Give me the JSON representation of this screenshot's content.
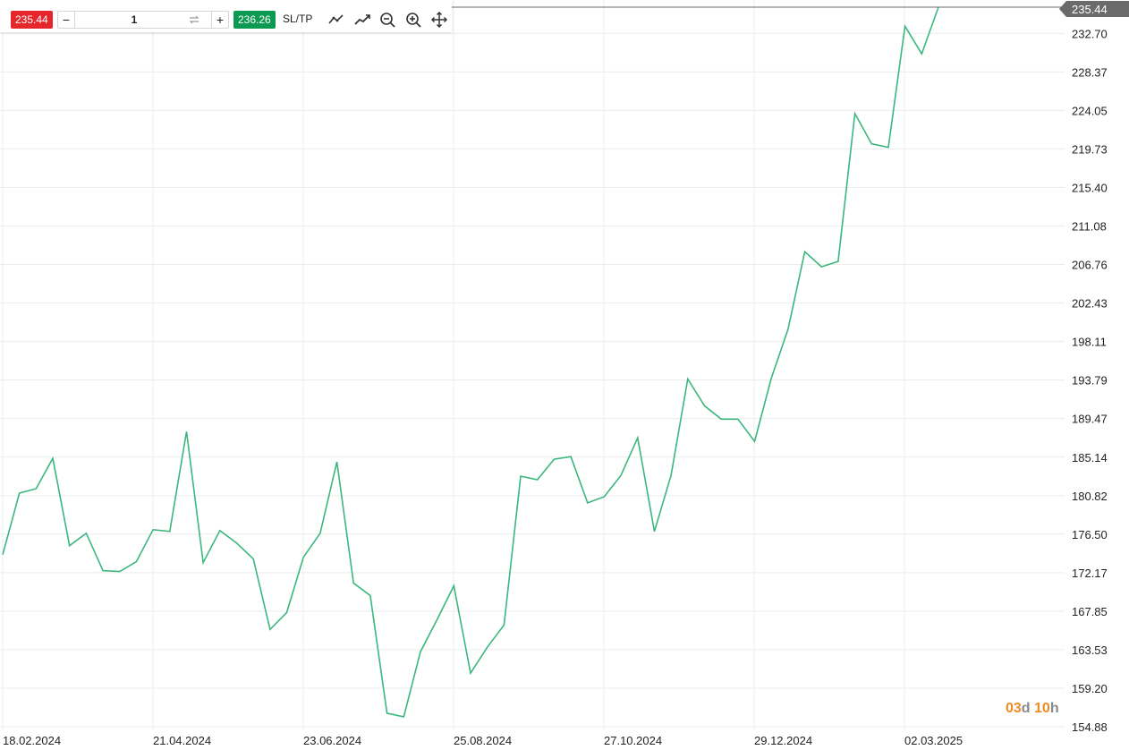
{
  "toolbar": {
    "sell_price": "235.44",
    "buy_price": "236.26",
    "quantity": "1",
    "minus_label": "−",
    "plus_label": "+",
    "sltp_label": "SL/TP",
    "icons": [
      "line-chart-icon",
      "trend-chart-icon",
      "zoom-out-icon",
      "zoom-in-icon",
      "pan-move-icon"
    ]
  },
  "colors": {
    "sell": "#e5262b",
    "buy": "#0c9a52",
    "line": "#3bb77e",
    "grid": "#ececec",
    "price_tag": "#6b6b6b",
    "timer_accent": "#f08a24",
    "timer_muted": "#8a8a8a"
  },
  "timer": {
    "days": "03",
    "days_unit": "d",
    "hours": "10",
    "hours_unit": "h"
  },
  "chart_data": {
    "type": "line",
    "current_price": "235.44",
    "ylim": [
      154.88,
      235.44
    ],
    "y_ticks": [
      "232.70",
      "228.37",
      "224.05",
      "219.73",
      "215.40",
      "211.08",
      "206.76",
      "202.43",
      "198.11",
      "193.79",
      "189.47",
      "185.14",
      "180.82",
      "176.50",
      "172.17",
      "167.85",
      "163.53",
      "159.20",
      "154.88"
    ],
    "x_ticks": [
      "18.02.2024",
      "21.04.2024",
      "23.06.2024",
      "25.08.2024",
      "27.10.2024",
      "29.12.2024",
      "02.03.2025"
    ],
    "series": [
      {
        "values": [
          174.2,
          181.1,
          181.6,
          185.0,
          175.2,
          176.6,
          172.4,
          172.3,
          173.4,
          177.0,
          176.8,
          188.0,
          173.3,
          176.9,
          175.5,
          173.7,
          165.8,
          167.7,
          173.9,
          176.6,
          184.6,
          171.0,
          169.6,
          156.4,
          156.0,
          163.3,
          166.9,
          170.7,
          160.9,
          163.8,
          166.3,
          183.0,
          182.6,
          184.9,
          185.2,
          180.0,
          180.7,
          183.1,
          187.3,
          176.8,
          183.1,
          193.9,
          190.9,
          189.4,
          189.4,
          186.9,
          194.0,
          199.5,
          208.2,
          206.5,
          207.1,
          223.7,
          220.3,
          219.9,
          233.5,
          230.4,
          236.0
        ]
      }
    ]
  }
}
